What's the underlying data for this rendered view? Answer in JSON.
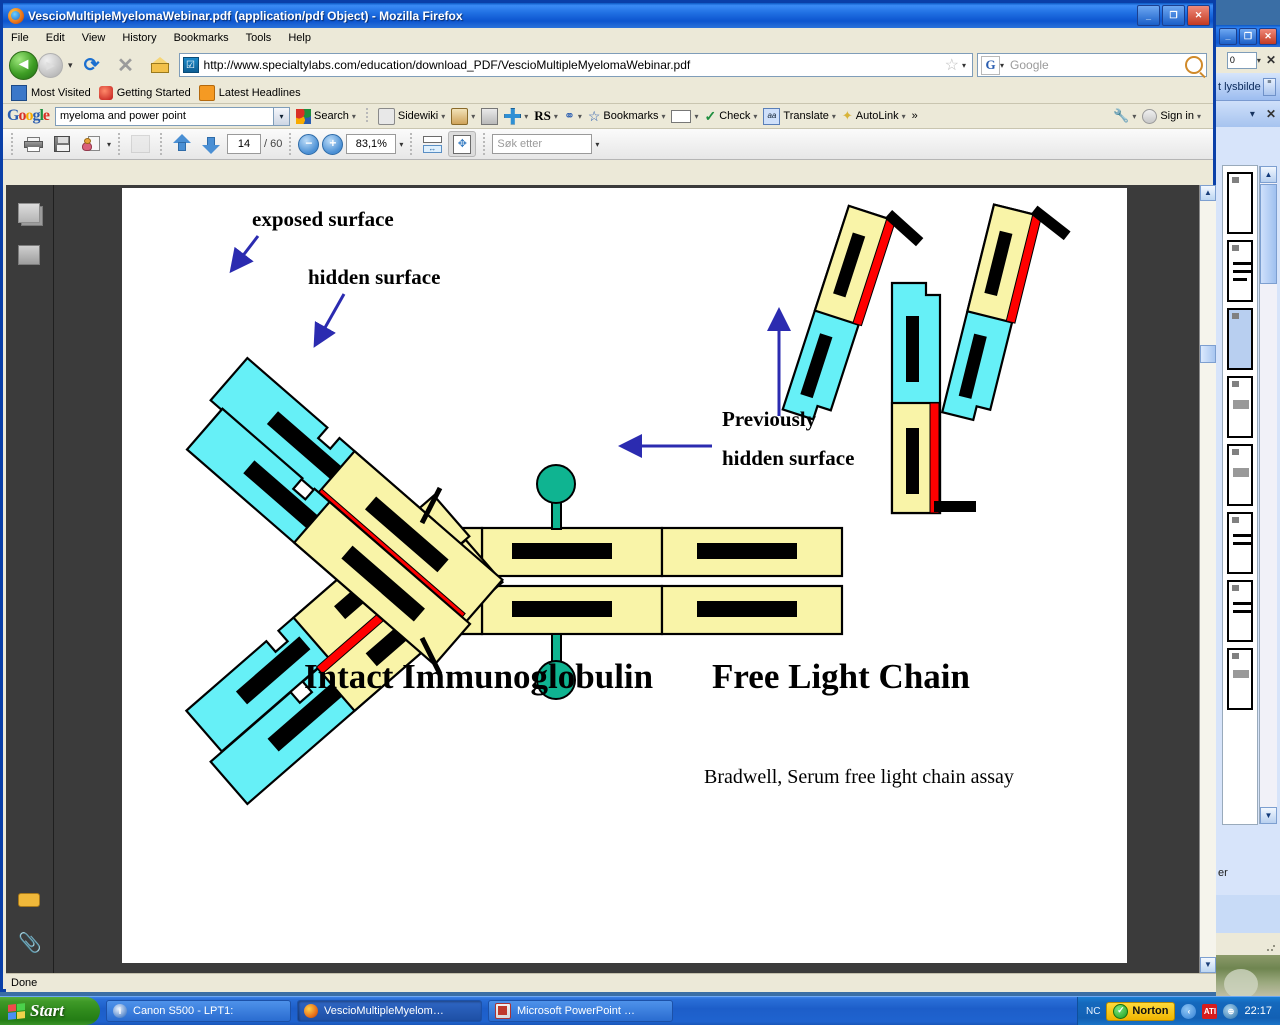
{
  "window": {
    "title": "VescioMultipleMyelomaWebinar.pdf (application/pdf Object) - Mozilla Firefox",
    "minimize_label": "_",
    "maximize_label": "❐",
    "close_label": "✕"
  },
  "menu": {
    "items": [
      "File",
      "Edit",
      "View",
      "History",
      "Bookmarks",
      "Tools",
      "Help"
    ]
  },
  "navbar": {
    "back_label": "◄",
    "forward_label": "►",
    "dropdown_label": "▾",
    "reload_label": "⟳",
    "stop_label": "✕",
    "home_name": "home-icon",
    "url": "http://www.specialtylabs.com/education/download_PDF/VescioMultipleMyelomaWebinar.pdf",
    "url_favicon_label": "☑",
    "bookmark_star": "☆",
    "url_dropdown": "▾",
    "search_engine": "G",
    "search_engine_caret": "▾",
    "search_placeholder": "Google",
    "search_icon_name": "magnifier-icon"
  },
  "bookmarks_bar": {
    "items": [
      {
        "label": "Most Visited",
        "icon": "blue-folder-icon"
      },
      {
        "label": "Getting Started",
        "icon": "firefox-red-icon"
      },
      {
        "label": "Latest Headlines",
        "icon": "rss-icon"
      }
    ]
  },
  "google_toolbar": {
    "logo": "Google",
    "logo_letters": [
      "G",
      "o",
      "o",
      "g",
      "l",
      "e"
    ],
    "query": "myeloma and power point",
    "combo_caret": "▾",
    "buttons": [
      {
        "label": "Search",
        "icon": "google-colors-icon",
        "caret": "▾"
      },
      {
        "label": "Sidewiki",
        "icon": "speech-bubble-icon",
        "caret": "▾"
      },
      {
        "label": "",
        "icon": "news-icon",
        "caret": "▾"
      },
      {
        "label": "",
        "icon": "bank-icon",
        "caret": ""
      },
      {
        "label": "",
        "icon": "plus-icon",
        "caret": "▾"
      },
      {
        "label": "RS",
        "icon": "rs-icon",
        "caret": "▾"
      },
      {
        "label": "",
        "icon": "link-icon",
        "caret": "▾"
      },
      {
        "label": "Bookmarks",
        "icon": "star-icon",
        "caret": "▾"
      },
      {
        "label": "",
        "icon": "popup-blocker-icon",
        "caret": "▾"
      },
      {
        "label": "Check",
        "icon": "spellcheck-icon",
        "caret": "▾"
      },
      {
        "label": "Translate",
        "icon": "translate-icon",
        "caret": "▾"
      },
      {
        "label": "AutoLink",
        "icon": "wand-icon",
        "caret": "▾"
      },
      {
        "label": "»",
        "icon": "overflow-icon",
        "caret": ""
      }
    ],
    "settings_icon": "wrench-icon",
    "settings_caret": "▾",
    "signin_label": "Sign in",
    "signin_caret": "▾"
  },
  "pdf_toolbar": {
    "print_icon": "print-icon",
    "save_icon": "save-icon",
    "email_icon": "email-icon",
    "email_caret": "▾",
    "secure_icon": "secure-document-icon",
    "prev_icon": "arrow-up-icon",
    "next_icon": "arrow-down-icon",
    "page_number": "14",
    "page_total": "/ 60",
    "zoom_out_label": "−",
    "zoom_in_label": "+",
    "zoom_value": "83,1%",
    "zoom_caret": "▾",
    "fit_width_icon": "fit-width-icon",
    "fit_page_icon": "fit-page-icon",
    "find_placeholder": "Søk etter",
    "find_caret": "▾"
  },
  "pdf_sidebar": {
    "items": [
      {
        "name": "pages-panel-icon"
      },
      {
        "name": "bookmarks-panel-icon"
      },
      {
        "name": "comments-panel-icon"
      },
      {
        "name": "attachments-panel-icon"
      }
    ]
  },
  "scrollbar": {
    "up_label": "▲",
    "down_label": "▼"
  },
  "status_bar": {
    "text": "Done"
  },
  "slide": {
    "annotations": {
      "exposed_surface": "exposed surface",
      "hidden_surface": "hidden surface",
      "previously_line1": "Previously",
      "previously_line2": "hidden surface"
    },
    "titles": {
      "left": "Intact Immunoglobulin",
      "right": "Free Light Chain"
    },
    "citation": "Bradwell, Serum free light chain assay",
    "colors": {
      "light_chain": "#66f0f7",
      "heavy_chain": "#f9f4a8",
      "hidden_surface": "#ff0000",
      "carbohydrate": "#0fb491",
      "outline": "#000000",
      "annotation_arrow": "#2b2bb0"
    }
  },
  "powerpoint_window": {
    "minimize_label": "_",
    "maximize_label": "❐",
    "close_label": "✕",
    "combo_value": "0",
    "combo_caret": "▾",
    "close_x": "✕",
    "task_pane_title": "t lysbilde",
    "pane_caret": "▾",
    "pane_close": "✕",
    "status_text": "er",
    "scroll_up": "▲",
    "scroll_down": "▼"
  },
  "taskbar": {
    "start_label": "Start",
    "items": [
      {
        "label": "Canon S500 - LPT1:",
        "icon": "info-icon",
        "active": false
      },
      {
        "label": "VescioMultipleMyelom…",
        "icon": "firefox-icon",
        "active": true
      },
      {
        "label": "Microsoft PowerPoint …",
        "icon": "powerpoint-icon",
        "active": false
      }
    ],
    "tray": {
      "nc_label": "NC",
      "norton_label": "Norton",
      "norton_check": "✓",
      "chevron_label": "‹",
      "ati_label": "ATI",
      "network_label": "⊕",
      "clock": "22:17"
    }
  }
}
